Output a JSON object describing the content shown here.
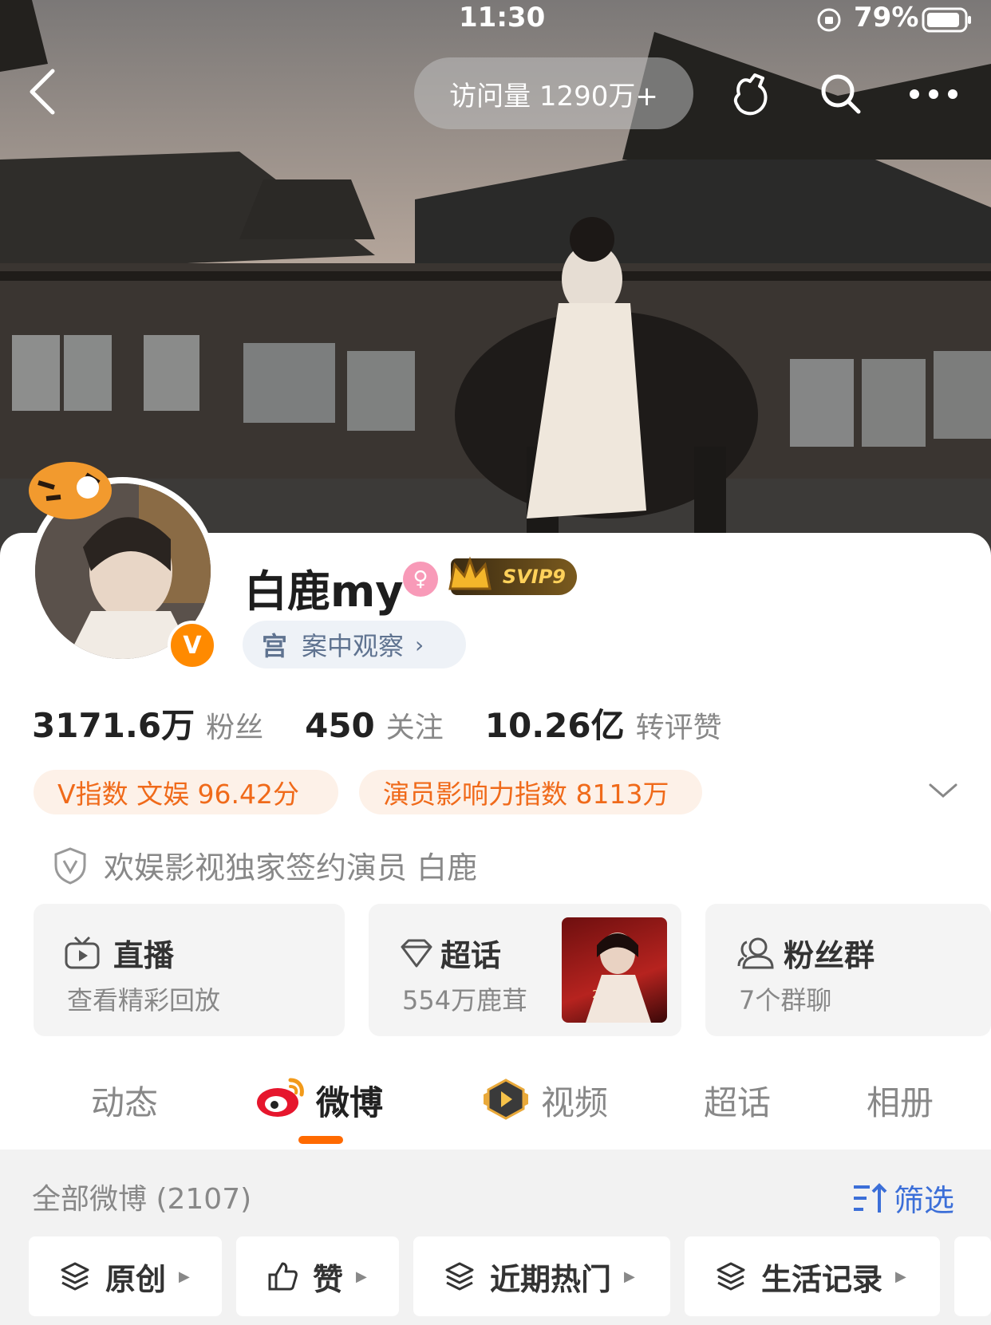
{
  "status_bar": {
    "time": "11:30",
    "battery": "79%"
  },
  "header": {
    "visits": "访问量 1290万+"
  },
  "profile": {
    "name": "白鹿my",
    "vip": "SVIP9",
    "title": "案中观察",
    "verify_text": "欢娱影视独家签约演员 白鹿"
  },
  "stats": [
    {
      "value": "3171.6万",
      "label": "粉丝"
    },
    {
      "value": "450",
      "label": "关注"
    },
    {
      "value": "10.26亿",
      "label": "转评赞"
    }
  ],
  "tags": [
    "V指数 文娱 96.42分",
    "演员影响力指数 8113万"
  ],
  "quick_cards": {
    "live": {
      "title": "直播",
      "sub": "查看精彩回放"
    },
    "topic": {
      "title": "超话",
      "sub": "554万鹿茸",
      "poster_text": "2月5日起"
    },
    "fans": {
      "title": "粉丝群",
      "sub": "7个群聊"
    }
  },
  "tabs": [
    "动态",
    "微博",
    "视频",
    "超话",
    "相册"
  ],
  "feed": {
    "header": "全部微博 (2107)",
    "filter": "筛选",
    "chips": [
      "原创",
      "赞",
      "近期热门",
      "生活记录"
    ]
  },
  "colors": {
    "accent": "#ff6a00",
    "link": "#3c6fd8",
    "tag_text": "#f06a1a"
  }
}
